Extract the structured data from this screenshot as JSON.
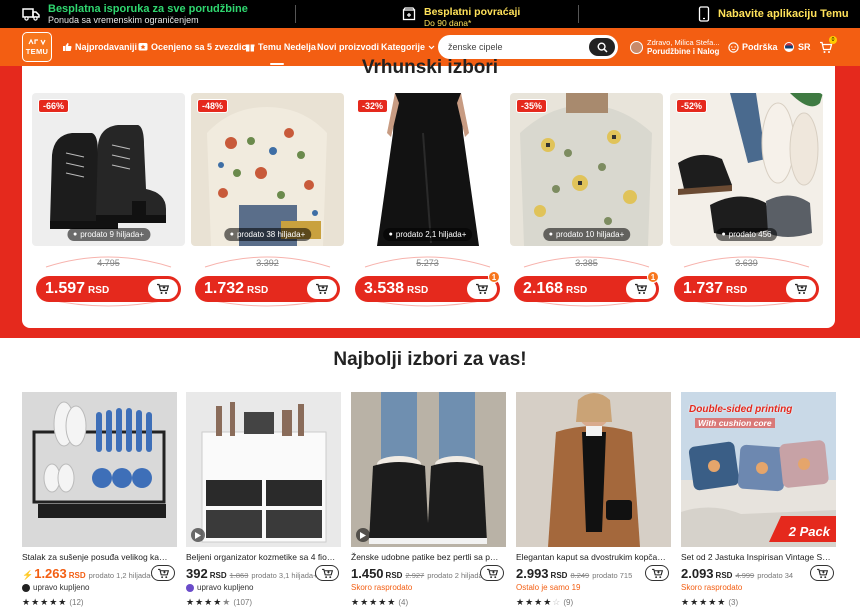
{
  "promo": {
    "shipping_title": "Besplatna isporuka za sve porudžbine",
    "shipping_sub": "Ponuda sa vremenskim ograničenjem",
    "returns_title": "Besplatni povraćaji",
    "returns_sub": "Do 90 dana*",
    "app_title": "Nabavite aplikaciju Temu"
  },
  "header": {
    "logo_text": "TEMU",
    "nav": [
      "Najprodavaniji",
      "Ocenjeno sa 5 zvezdica",
      "Temu Nedelja",
      "Novi proizvodi",
      "Kategorije"
    ],
    "search_placeholder": "ženske cipele",
    "account_line1": "Zdravo, Milica Stefa...",
    "account_line2": "Porudžbine i Nalog",
    "support": "Podrška",
    "language": "SR",
    "cart_count": "0"
  },
  "top_picks": {
    "title": "Vrhunski izbori",
    "items": [
      {
        "discount": "-66%",
        "sold": "prodato 9 hiljada+",
        "old_price": "4.795",
        "price": "1.597",
        "currency": "RSD",
        "badge": ""
      },
      {
        "discount": "-48%",
        "sold": "prodato 38 hiljada+",
        "old_price": "3.392",
        "price": "1.732",
        "currency": "RSD",
        "badge": ""
      },
      {
        "discount": "-32%",
        "sold": "prodato 2,1 hiljada+",
        "old_price": "5.273",
        "price": "3.538",
        "currency": "RSD",
        "badge": "1"
      },
      {
        "discount": "-35%",
        "sold": "prodato 10 hiljada+",
        "old_price": "3.385",
        "price": "2.168",
        "currency": "RSD",
        "badge": "1"
      },
      {
        "discount": "-52%",
        "sold": "prodato 456",
        "old_price": "3.639",
        "price": "1.737",
        "currency": "RSD",
        "badge": ""
      }
    ]
  },
  "best_picks": {
    "title": "Najbolji izbori za vas!",
    "items": [
      {
        "name": "Stalak za sušenje posuđa velikog kapaci...",
        "price": "1.263",
        "currency": "RSD",
        "old_price": "",
        "sold": "prodato 1,2 hiljada+",
        "info": "upravo kupljeno",
        "rating": 5,
        "reviews": "(12)"
      },
      {
        "name": "Beljeni organizator kozmetike sa 4 fioke...",
        "price": "392",
        "currency": "RSD",
        "old_price": "1.863",
        "sold": "prodato 3,1 hiljada+",
        "info": "upravo kupljeno",
        "rating": 4.5,
        "reviews": "(107)"
      },
      {
        "name": "Ženske udobne patike bez pertli sa pos...",
        "price": "1.450",
        "currency": "RSD",
        "old_price": "2.927",
        "sold": "prodato 2 hiljada+",
        "info": "Skoro rasprodato",
        "rating": 5,
        "reviews": "(4)"
      },
      {
        "name": "Elegantan kaput sa dvostrukim kopčanj...",
        "price": "2.993",
        "currency": "RSD",
        "old_price": "8.249",
        "sold": "prodato 715",
        "info": "Ostalo je samo 19",
        "rating": 4,
        "reviews": "(9)"
      },
      {
        "name": "Set od 2 Jastuka Inspirisan Vintage Stilo...",
        "price": "2.093",
        "currency": "RSD",
        "old_price": "4.999",
        "sold": "prodato 34",
        "info": "Skoro rasprodato",
        "rating": 5,
        "reviews": "(3)"
      }
    ],
    "banner_text1": "Double-sided printing",
    "banner_text2": "With cushion core",
    "banner_pack": "2 Pack"
  },
  "colors": {
    "brand_orange": "#f35e12",
    "sale_red": "#e5291d",
    "promo_green": "#2fd66f",
    "promo_yellow": "#ffe25a"
  }
}
